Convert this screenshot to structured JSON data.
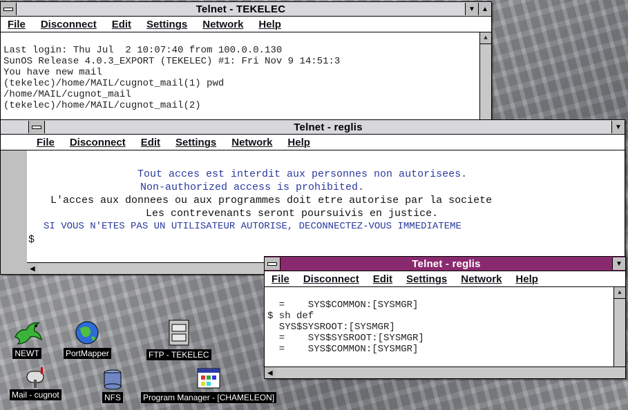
{
  "menus": [
    "File",
    "Disconnect",
    "Edit",
    "Settings",
    "Network",
    "Help"
  ],
  "win_tekelec": {
    "title": "Telnet - TEKELEC",
    "lines": [
      "Last login: Thu Jul  2 10:07:40 from 100.0.0.130",
      "SunOS Release 4.0.3_EXPORT (TEKELEC) #1: Fri Nov 9 14:51:3",
      "You have new mail",
      "(tekelec)/home/MAIL/cugnot_mail(1) pwd",
      "/home/MAIL/cugnot_mail",
      "(tekelec)/home/MAIL/cugnot_mail(2)"
    ]
  },
  "win_reglis1": {
    "title": "Telnet - reglis",
    "lines": [
      "Tout acces est interdit aux personnes non autorisees.",
      "Non-authorized access is prohibited.",
      "L'acces aux donnees ou aux programmes doit etre autorise par la societe",
      "Les contrevenants seront poursuivis en justice.",
      "SI VOUS N'ETES PAS UN UTILISATEUR AUTORISE, DECONNECTEZ-VOUS IMMEDIATEME",
      "$"
    ]
  },
  "win_reglis2": {
    "title": "Telnet - reglis",
    "lines": [
      "  =    SYS$COMMON:[SYSMGR]",
      "$ sh def",
      "  SYS$SYSROOT:[SYSMGR]",
      "  =    SYS$SYSROOT:[SYSMGR]",
      "  =    SYS$COMMON:[SYSMGR]"
    ]
  },
  "desktop_icons": {
    "newt": "NEWT",
    "portmapper": "PortMapper",
    "ftp": "FTP - TEKELEC",
    "mail": "Mail - cugnot",
    "nfs": "NFS",
    "progman": "Program Manager - [CHAMELEON]"
  },
  "colors": {
    "active_title": "#8a2a6e",
    "terminal_blue": "#2a3a9e"
  }
}
